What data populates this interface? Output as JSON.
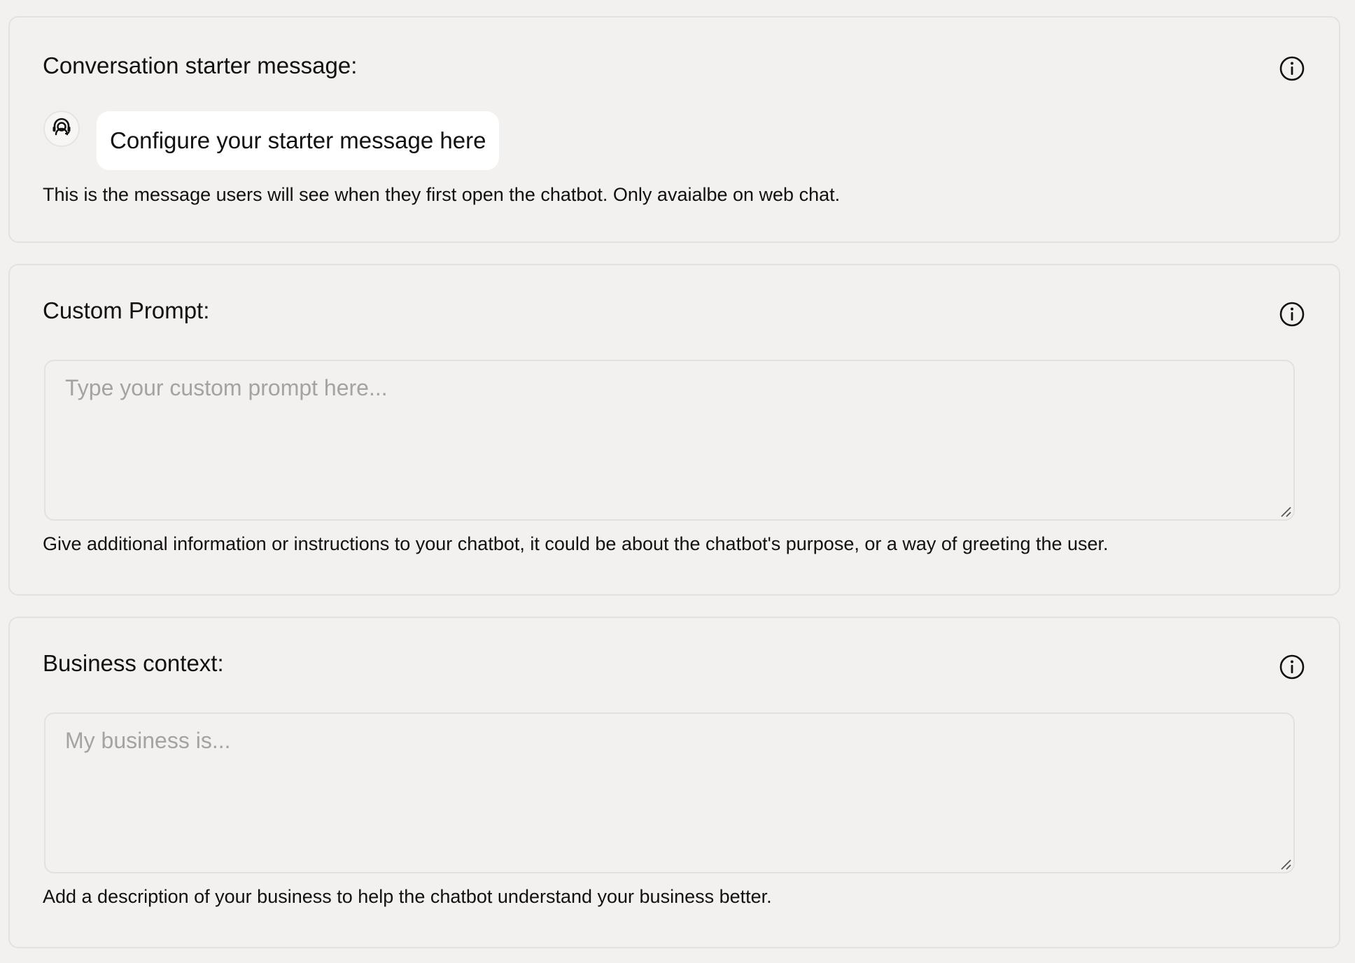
{
  "starter": {
    "title": "Conversation starter message:",
    "bubble_text": "Configure your starter message here",
    "help_text": "This is the message users will see when they first open the chatbot. Only avaialbe on web chat.",
    "avatar_icon": "headset-agent-icon",
    "info_icon": "info-circle-icon"
  },
  "custom_prompt": {
    "title": "Custom Prompt:",
    "placeholder": "Type your custom prompt here...",
    "value": "",
    "help_text": "Give additional information or instructions to your chatbot, it could be about the chatbot's purpose, or a way of greeting the user.",
    "info_icon": "info-circle-icon"
  },
  "business_context": {
    "title": "Business context:",
    "placeholder": "My business is...",
    "value": "",
    "help_text": "Add a description of your business to help the chatbot understand your business better.",
    "info_icon": "info-circle-icon"
  },
  "colors": {
    "background": "#f2f1ef",
    "card_border": "#e4e2de",
    "bubble": "#ffffff",
    "text": "#111111",
    "placeholder": "#a5a3a0"
  }
}
